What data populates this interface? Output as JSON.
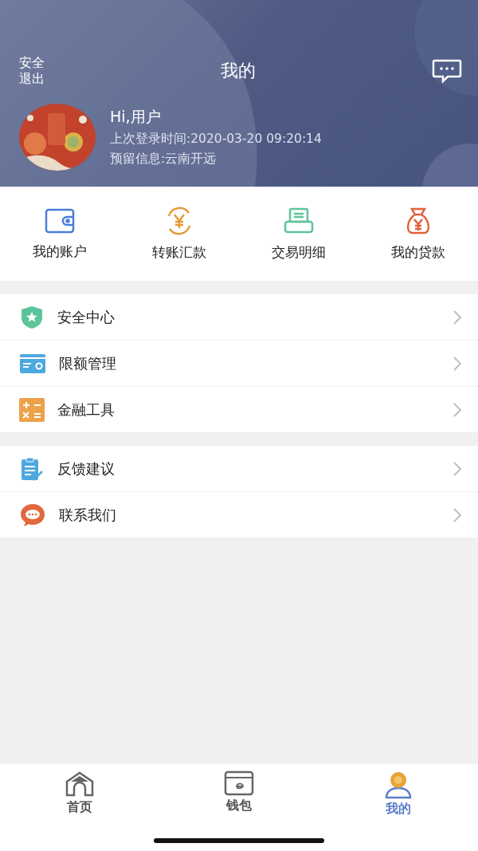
{
  "header": {
    "logout": "安全退出",
    "title": "我的"
  },
  "profile": {
    "kind": "picture",
    "greeting": "Hi,用户",
    "last_login": "上次登录时间:2020-03-20 09:20:14",
    "reserved_info": "预留信息:云南开远"
  },
  "shortcuts": [
    {
      "kind": "wallet",
      "label": "我的账户"
    },
    {
      "kind": "transfer",
      "label": "转账汇款"
    },
    {
      "kind": "statement",
      "label": "交易明细"
    },
    {
      "kind": "loan",
      "label": "我的贷款"
    }
  ],
  "menu_groups": [
    [
      {
        "kind": "shield",
        "label": "安全中心"
      },
      {
        "kind": "card",
        "label": "限额管理"
      },
      {
        "kind": "calculator",
        "label": "金融工具"
      }
    ],
    [
      {
        "kind": "feedback",
        "label": "反馈建议"
      },
      {
        "kind": "chat",
        "label": "联系我们"
      }
    ]
  ],
  "tab_bar": [
    {
      "kind": "home",
      "label": "首页",
      "selected": false
    },
    {
      "kind": "wallet",
      "label": "钱包",
      "selected": false
    },
    {
      "kind": "user",
      "label": "我的",
      "selected": true
    }
  ]
}
